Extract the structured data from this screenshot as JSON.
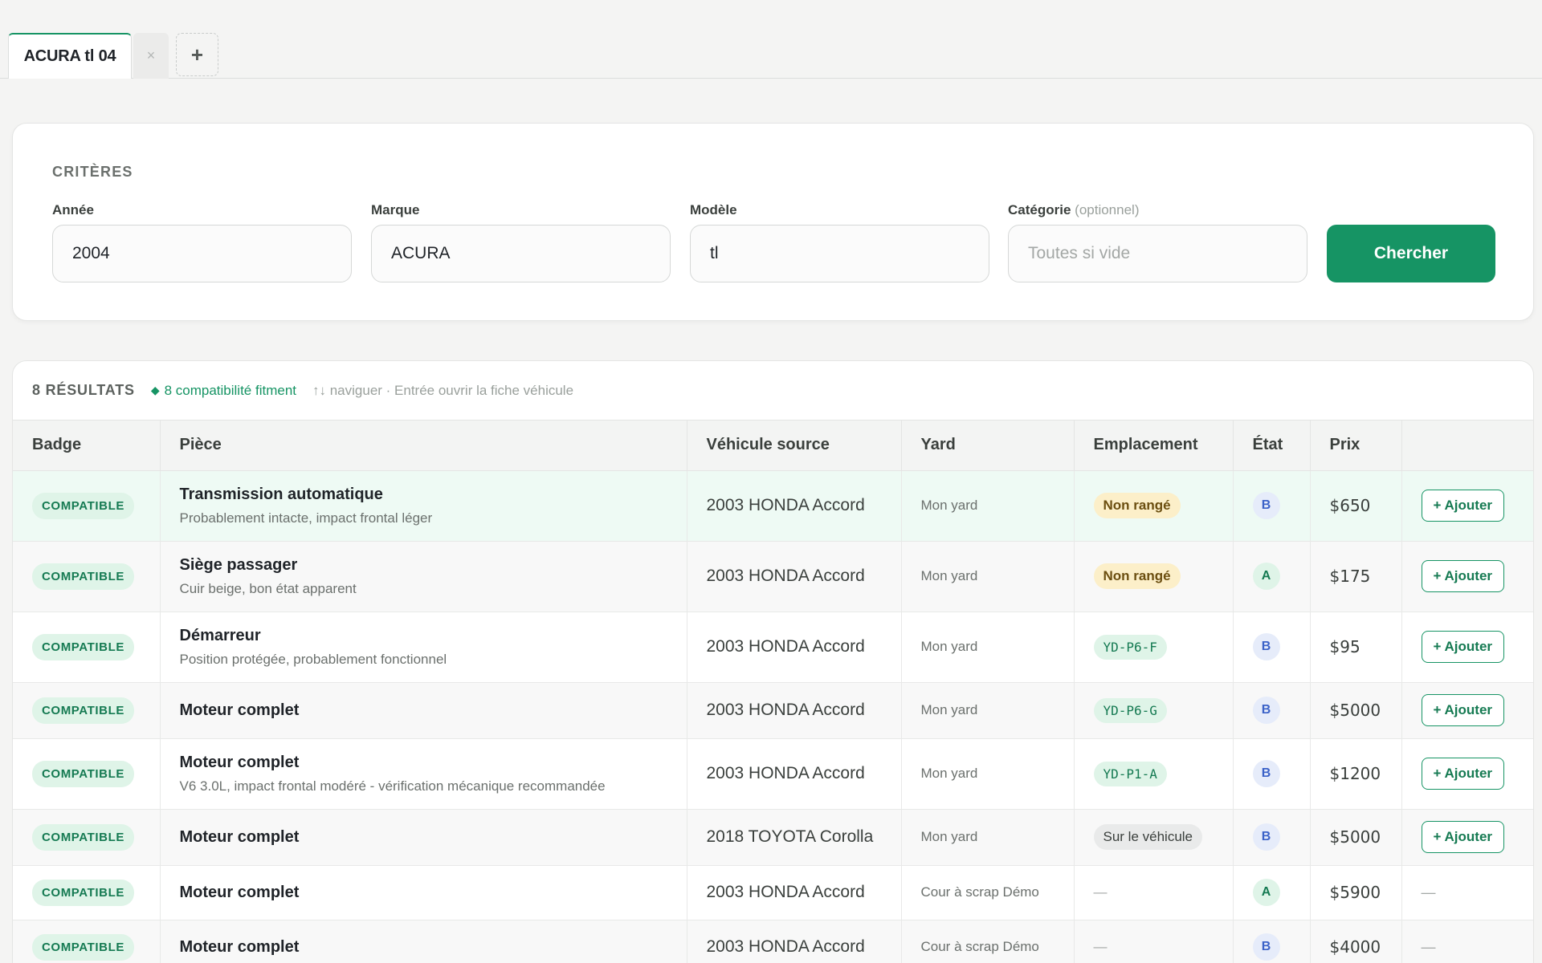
{
  "tabs": {
    "active_label": "ACURA tl 04",
    "close_label": "×",
    "add_label": "+"
  },
  "criteria": {
    "title": "CRITÈRES",
    "year_label": "Année",
    "year_value": "2004",
    "make_label": "Marque",
    "make_value": "ACURA",
    "model_label": "Modèle",
    "model_value": "tl",
    "category_label": "Catégorie",
    "category_optional": "(optionnel)",
    "category_placeholder": "Toutes si vide",
    "search_label": "Chercher"
  },
  "results": {
    "count": "8 RÉSULTATS",
    "compat_icon": "◆",
    "compat": "8 compatibilité fitment",
    "hint": "↑↓ naviguer · Entrée ouvrir la fiche véhicule",
    "columns": [
      "Badge",
      "Pièce",
      "Véhicule source",
      "Yard",
      "Emplacement",
      "État",
      "Prix",
      ""
    ],
    "rows": [
      {
        "badge": "COMPATIBLE",
        "name": "Transmission automatique",
        "desc": "Probablement intacte, impact frontal léger",
        "vehicle": "2003 HONDA Accord",
        "yard": "Mon yard",
        "location": "Non rangé",
        "location_style": "warn",
        "state": "B",
        "price": "$650",
        "action": "+ Ajouter"
      },
      {
        "badge": "COMPATIBLE",
        "name": "Siège passager",
        "desc": "Cuir beige, bon état apparent",
        "vehicle": "2003 HONDA Accord",
        "yard": "Mon yard",
        "location": "Non rangé",
        "location_style": "warn",
        "state": "A",
        "price": "$175",
        "action": "+ Ajouter"
      },
      {
        "badge": "COMPATIBLE",
        "name": "Démarreur",
        "desc": "Position protégée, probablement fonctionnel",
        "vehicle": "2003 HONDA Accord",
        "yard": "Mon yard",
        "location": "YD-P6-F",
        "location_style": "code",
        "state": "B",
        "price": "$95",
        "action": "+ Ajouter"
      },
      {
        "badge": "COMPATIBLE",
        "name": "Moteur complet",
        "desc": "",
        "vehicle": "2003 HONDA Accord",
        "yard": "Mon yard",
        "location": "YD-P6-G",
        "location_style": "code",
        "state": "B",
        "price": "$5000",
        "action": "+ Ajouter"
      },
      {
        "badge": "COMPATIBLE",
        "name": "Moteur complet",
        "desc": "V6 3.0L, impact frontal modéré - vérification mécanique recommandée",
        "vehicle": "2003 HONDA Accord",
        "yard": "Mon yard",
        "location": "YD-P1-A",
        "location_style": "code",
        "state": "B",
        "price": "$1200",
        "action": "+ Ajouter"
      },
      {
        "badge": "COMPATIBLE",
        "name": "Moteur complet",
        "desc": "",
        "vehicle": "2018 TOYOTA Corolla",
        "yard": "Mon yard",
        "location": "Sur le véhicule",
        "location_style": "grey",
        "state": "B",
        "price": "$5000",
        "action": "+ Ajouter"
      },
      {
        "badge": "COMPATIBLE",
        "name": "Moteur complet",
        "desc": "",
        "vehicle": "2003 HONDA Accord",
        "yard": "Cour à scrap Démo",
        "location": "—",
        "location_style": "none",
        "state": "A",
        "price": "$5900",
        "action": "—"
      },
      {
        "badge": "COMPATIBLE",
        "name": "Moteur complet",
        "desc": "",
        "vehicle": "2003 HONDA Accord",
        "yard": "Cour à scrap Démo",
        "location": "—",
        "location_style": "none",
        "state": "B",
        "price": "$4000",
        "action": "—"
      }
    ]
  }
}
